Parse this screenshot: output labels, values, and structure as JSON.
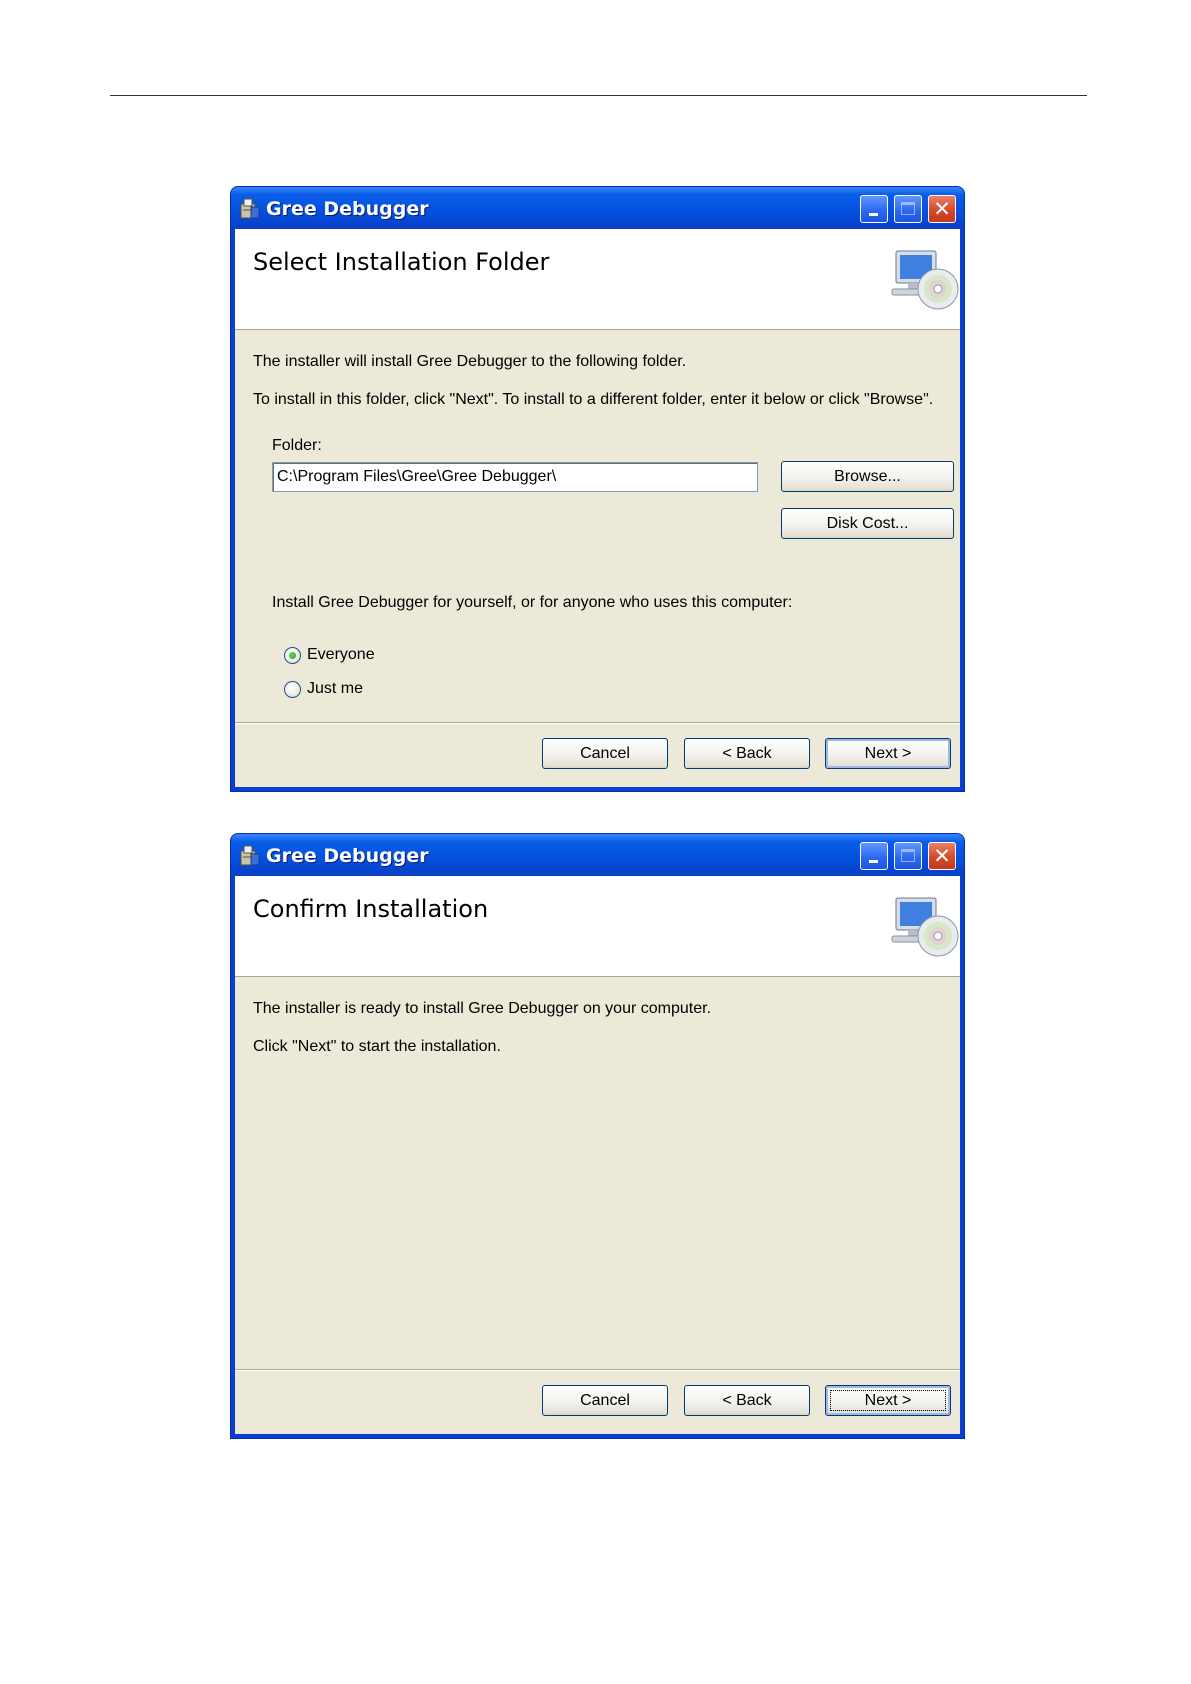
{
  "dialogs": [
    {
      "window_title": "Gree Debugger",
      "banner_title": "Select Installation Folder",
      "line1": "The installer will install Gree Debugger to the following folder.",
      "line2": "To install in this folder, click \"Next\". To install to a different folder, enter it below or click \"Browse\".",
      "folder_label": "Folder:",
      "folder_value": "C:\\Program Files\\Gree\\Gree Debugger\\",
      "browse_label": "Browse...",
      "disk_cost_label": "Disk Cost...",
      "install_for_prompt": "Install Gree Debugger for yourself, or for anyone who uses this computer:",
      "radio_options": [
        {
          "label": "Everyone",
          "selected": true
        },
        {
          "label": "Just me",
          "selected": false
        }
      ],
      "cancel_label": "Cancel",
      "back_label": "< Back",
      "next_label": "Next >"
    },
    {
      "window_title": "Gree Debugger",
      "banner_title": "Confirm Installation",
      "line1": "The installer is ready to install Gree Debugger on your computer.",
      "line2": "Click \"Next\" to start the installation.",
      "cancel_label": "Cancel",
      "back_label": "< Back",
      "next_label": "Next >"
    }
  ],
  "icons": {
    "title_icon": "installer-package-icon",
    "banner_icon": "computer-cd-setup-icon",
    "minimize": "minimize-icon",
    "maximize": "maximize-icon",
    "close": "close-icon"
  },
  "colors": {
    "titlebar": "#0551e0",
    "dialog_background": "#ece9d8",
    "close_button": "#d8482a"
  }
}
